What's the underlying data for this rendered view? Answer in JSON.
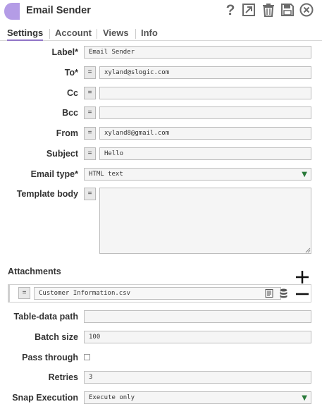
{
  "header": {
    "title": "Email Sender",
    "accent_color": "#b49ce6"
  },
  "tabs": [
    {
      "label": "Settings",
      "active": true
    },
    {
      "label": "Account",
      "active": false
    },
    {
      "label": "Views",
      "active": false
    },
    {
      "label": "Info",
      "active": false
    }
  ],
  "form": {
    "label": {
      "label": "Label*",
      "value": "Email Sender"
    },
    "to": {
      "label": "To*",
      "value": "xyland@slogic.com"
    },
    "cc": {
      "label": "Cc",
      "value": ""
    },
    "bcc": {
      "label": "Bcc",
      "value": ""
    },
    "from": {
      "label": "From",
      "value": "xyland8@gmail.com"
    },
    "subject": {
      "label": "Subject",
      "value": "Hello"
    },
    "email_type": {
      "label": "Email type*",
      "value": "HTML text"
    },
    "template_body": {
      "label": "Template body",
      "value": ""
    },
    "attachments": {
      "label": "Attachments",
      "items": [
        "Customer Information.csv"
      ]
    },
    "table_data_path": {
      "label": "Table-data path",
      "value": ""
    },
    "batch_size": {
      "label": "Batch size",
      "value": "100"
    },
    "pass_through": {
      "label": "Pass through",
      "checked": false
    },
    "retries": {
      "label": "Retries",
      "value": "3"
    },
    "snap_execution": {
      "label": "Snap Execution",
      "value": "Execute only"
    }
  },
  "icons": {
    "help": "help-icon",
    "expand": "expand-icon",
    "delete": "trash-icon",
    "save": "save-icon",
    "close": "close-icon",
    "expression": "=",
    "add": "+",
    "remove": "−"
  }
}
